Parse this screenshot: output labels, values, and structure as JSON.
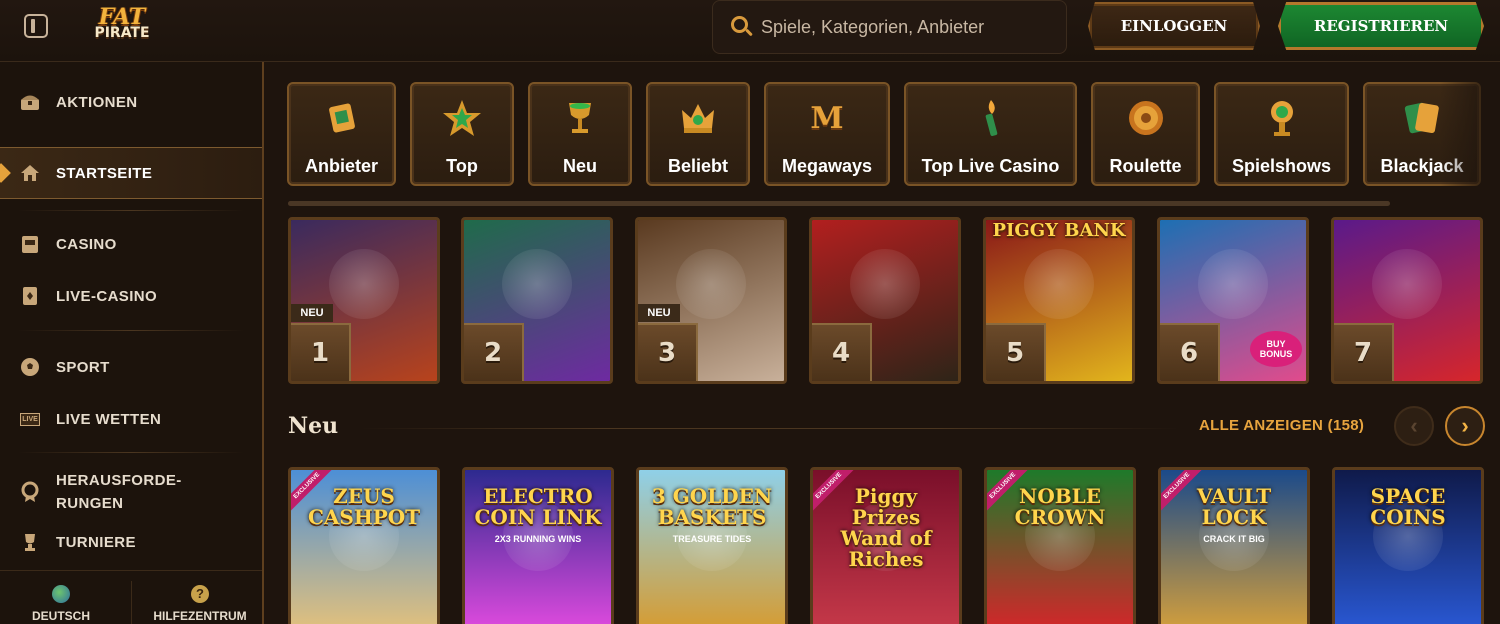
{
  "header": {
    "logo_line1": "FAT",
    "logo_line2": "PIRATE",
    "search_placeholder": "Spiele, Kategorien, Anbieter",
    "login_label": "EINLOGGEN",
    "register_label": "REGISTRIEREN"
  },
  "sidebar": {
    "items": [
      {
        "label": "AKTIONEN",
        "icon": "chest-icon"
      },
      {
        "label": "STARTSEITE",
        "icon": "home-icon",
        "active": true
      },
      {
        "label": "CASINO",
        "icon": "slot-machine-icon"
      },
      {
        "label": "LIVE-CASINO",
        "icon": "cards-icon"
      },
      {
        "label": "SPORT",
        "icon": "football-icon"
      },
      {
        "label": "LIVE WETTEN",
        "icon": "live-icon"
      },
      {
        "label": "HERAUSFORDE-",
        "label2": "RUNGEN",
        "icon": "medal-icon"
      },
      {
        "label": "TURNIERE",
        "icon": "trophy-icon"
      }
    ],
    "live_icon_text": "LIVE",
    "footer": {
      "language": "DEUTSCH",
      "help": "HILFEZENTRUM",
      "help_icon_glyph": "?"
    }
  },
  "categories": [
    {
      "label": "Anbieter",
      "icon": "scroll-icon",
      "glyph": "📜"
    },
    {
      "label": "Top",
      "icon": "star-icon",
      "glyph": "★"
    },
    {
      "label": "Neu",
      "icon": "goblet-icon",
      "glyph": "🏆"
    },
    {
      "label": "Beliebt",
      "icon": "crown-icon",
      "glyph": "👑"
    },
    {
      "label": "Megaways",
      "icon": "megaways-icon",
      "glyph": "M"
    },
    {
      "label": "Top Live Casino",
      "icon": "torch-icon",
      "glyph": "🔥"
    },
    {
      "label": "Roulette",
      "icon": "roulette-icon",
      "glyph": "◎"
    },
    {
      "label": "Spielshows",
      "icon": "microphone-icon",
      "glyph": "🎤"
    },
    {
      "label": "Blackjack",
      "icon": "cards-icon",
      "glyph": "🂡"
    }
  ],
  "top_games": {
    "tiles": [
      {
        "rank": "1",
        "badge": "NEU",
        "colors": [
          "#3a2a5e",
          "#b8431c"
        ]
      },
      {
        "rank": "2",
        "badge": "",
        "colors": [
          "#1f6b4a",
          "#6e2aa1"
        ]
      },
      {
        "rank": "3",
        "badge": "NEU",
        "colors": [
          "#5a3a20",
          "#c8b09a"
        ]
      },
      {
        "rank": "4",
        "badge": "",
        "colors": [
          "#b21f1f",
          "#2e2418"
        ]
      },
      {
        "rank": "5",
        "badge": "",
        "colors": [
          "#8a1818",
          "#e2b51c"
        ],
        "title": "PIGGY BANK"
      },
      {
        "rank": "6",
        "badge": "",
        "colors": [
          "#1d6fb3",
          "#e14b8c"
        ],
        "sub": "BUY BONUS"
      },
      {
        "rank": "7",
        "badge": "",
        "colors": [
          "#5a1a8a",
          "#d6262b"
        ]
      }
    ]
  },
  "new_section": {
    "title": "Neu",
    "view_all": "ALLE ANZEIGEN (158)",
    "prev_glyph": "‹",
    "next_glyph": "›",
    "tiles": [
      {
        "title": "ZEUS CASHPOT",
        "exclusive": true,
        "colors": [
          "#4d8fd6",
          "#e6c27a"
        ]
      },
      {
        "title": "ELECTRO COIN LINK",
        "sub": "2X3 RUNNING WINS",
        "exclusive": false,
        "colors": [
          "#2d2a8f",
          "#e34be0"
        ]
      },
      {
        "title": "3 GOLDEN BASKETS",
        "sub": "TREASURE TIDES",
        "exclusive": false,
        "colors": [
          "#8fd0e8",
          "#d89a2c"
        ]
      },
      {
        "title": "Piggy Prizes Wand of Riches",
        "exclusive": true,
        "colors": [
          "#7a0f2a",
          "#c83a4a"
        ]
      },
      {
        "title": "NOBLE CROWN",
        "exclusive": true,
        "colors": [
          "#1e7a2a",
          "#d8242a"
        ]
      },
      {
        "title": "VAULT LOCK",
        "sub": "CRACK IT BIG",
        "exclusive": true,
        "colors": [
          "#1b4a8a",
          "#d8a13a"
        ]
      },
      {
        "title": "SPACE COINS",
        "exclusive": false,
        "colors": [
          "#0f1a4a",
          "#2a5ad8"
        ]
      }
    ],
    "exclusive_label": "EXCLUSIVE"
  }
}
